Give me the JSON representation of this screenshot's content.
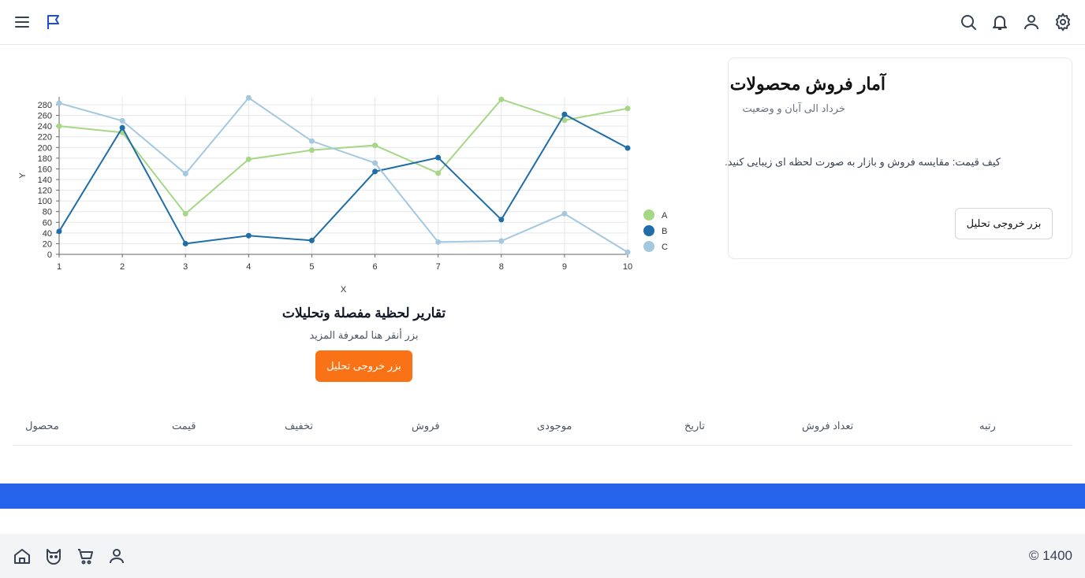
{
  "header": {
    "icons": [
      "menu-icon",
      "flag-icon",
      "search-icon",
      "bell-icon",
      "user-icon",
      "gear-icon"
    ]
  },
  "card": {
    "title": "آمار فروش محصولات",
    "subtitle": "خرداد الی آبان و وضعیت",
    "description": "کیف قیمت: مقایسه فروش و بازار به صورت لحظه ای زیبایی کنید.",
    "button_label": "بزر خروجی تحلیل"
  },
  "chart_data": {
    "type": "line",
    "x": [
      1,
      2,
      3,
      4,
      5,
      6,
      7,
      8,
      9,
      10
    ],
    "xlabel": "X",
    "ylabel": "Y",
    "ylim": [
      0,
      280
    ],
    "yticks": [
      0,
      20,
      40,
      60,
      80,
      100,
      120,
      140,
      160,
      180,
      200,
      220,
      240,
      260,
      280
    ],
    "grid": true,
    "legend_position": "right",
    "series": [
      {
        "name": "A",
        "color": "#a6d785",
        "values": [
          240,
          228,
          76,
          178,
          195,
          204,
          152,
          290,
          251,
          273
        ]
      },
      {
        "name": "B",
        "color": "#1f6ea8",
        "values": [
          43,
          237,
          20,
          35,
          26,
          155,
          181,
          65,
          262,
          199
        ]
      },
      {
        "name": "C",
        "color": "#a3c8e0",
        "values": [
          283,
          250,
          151,
          293,
          212,
          171,
          23,
          25,
          76,
          4
        ]
      }
    ]
  },
  "promo": {
    "title": "تقارير لحظية مفصلة وتحليلات",
    "subtitle": "بزر أنقر هنا لمعرفة المزيد",
    "button_label": "بزر خروجی تحلیل"
  },
  "table": {
    "columns": [
      "محصول",
      "قیمت",
      "تخفیف",
      "فروش",
      "موجودی",
      "تاریخ",
      "تعداد فروش",
      "رتبه"
    ]
  },
  "footer": {
    "copyright": "© 1400",
    "icons": [
      "home-icon",
      "cat-icon",
      "cart-icon",
      "user-icon"
    ]
  }
}
